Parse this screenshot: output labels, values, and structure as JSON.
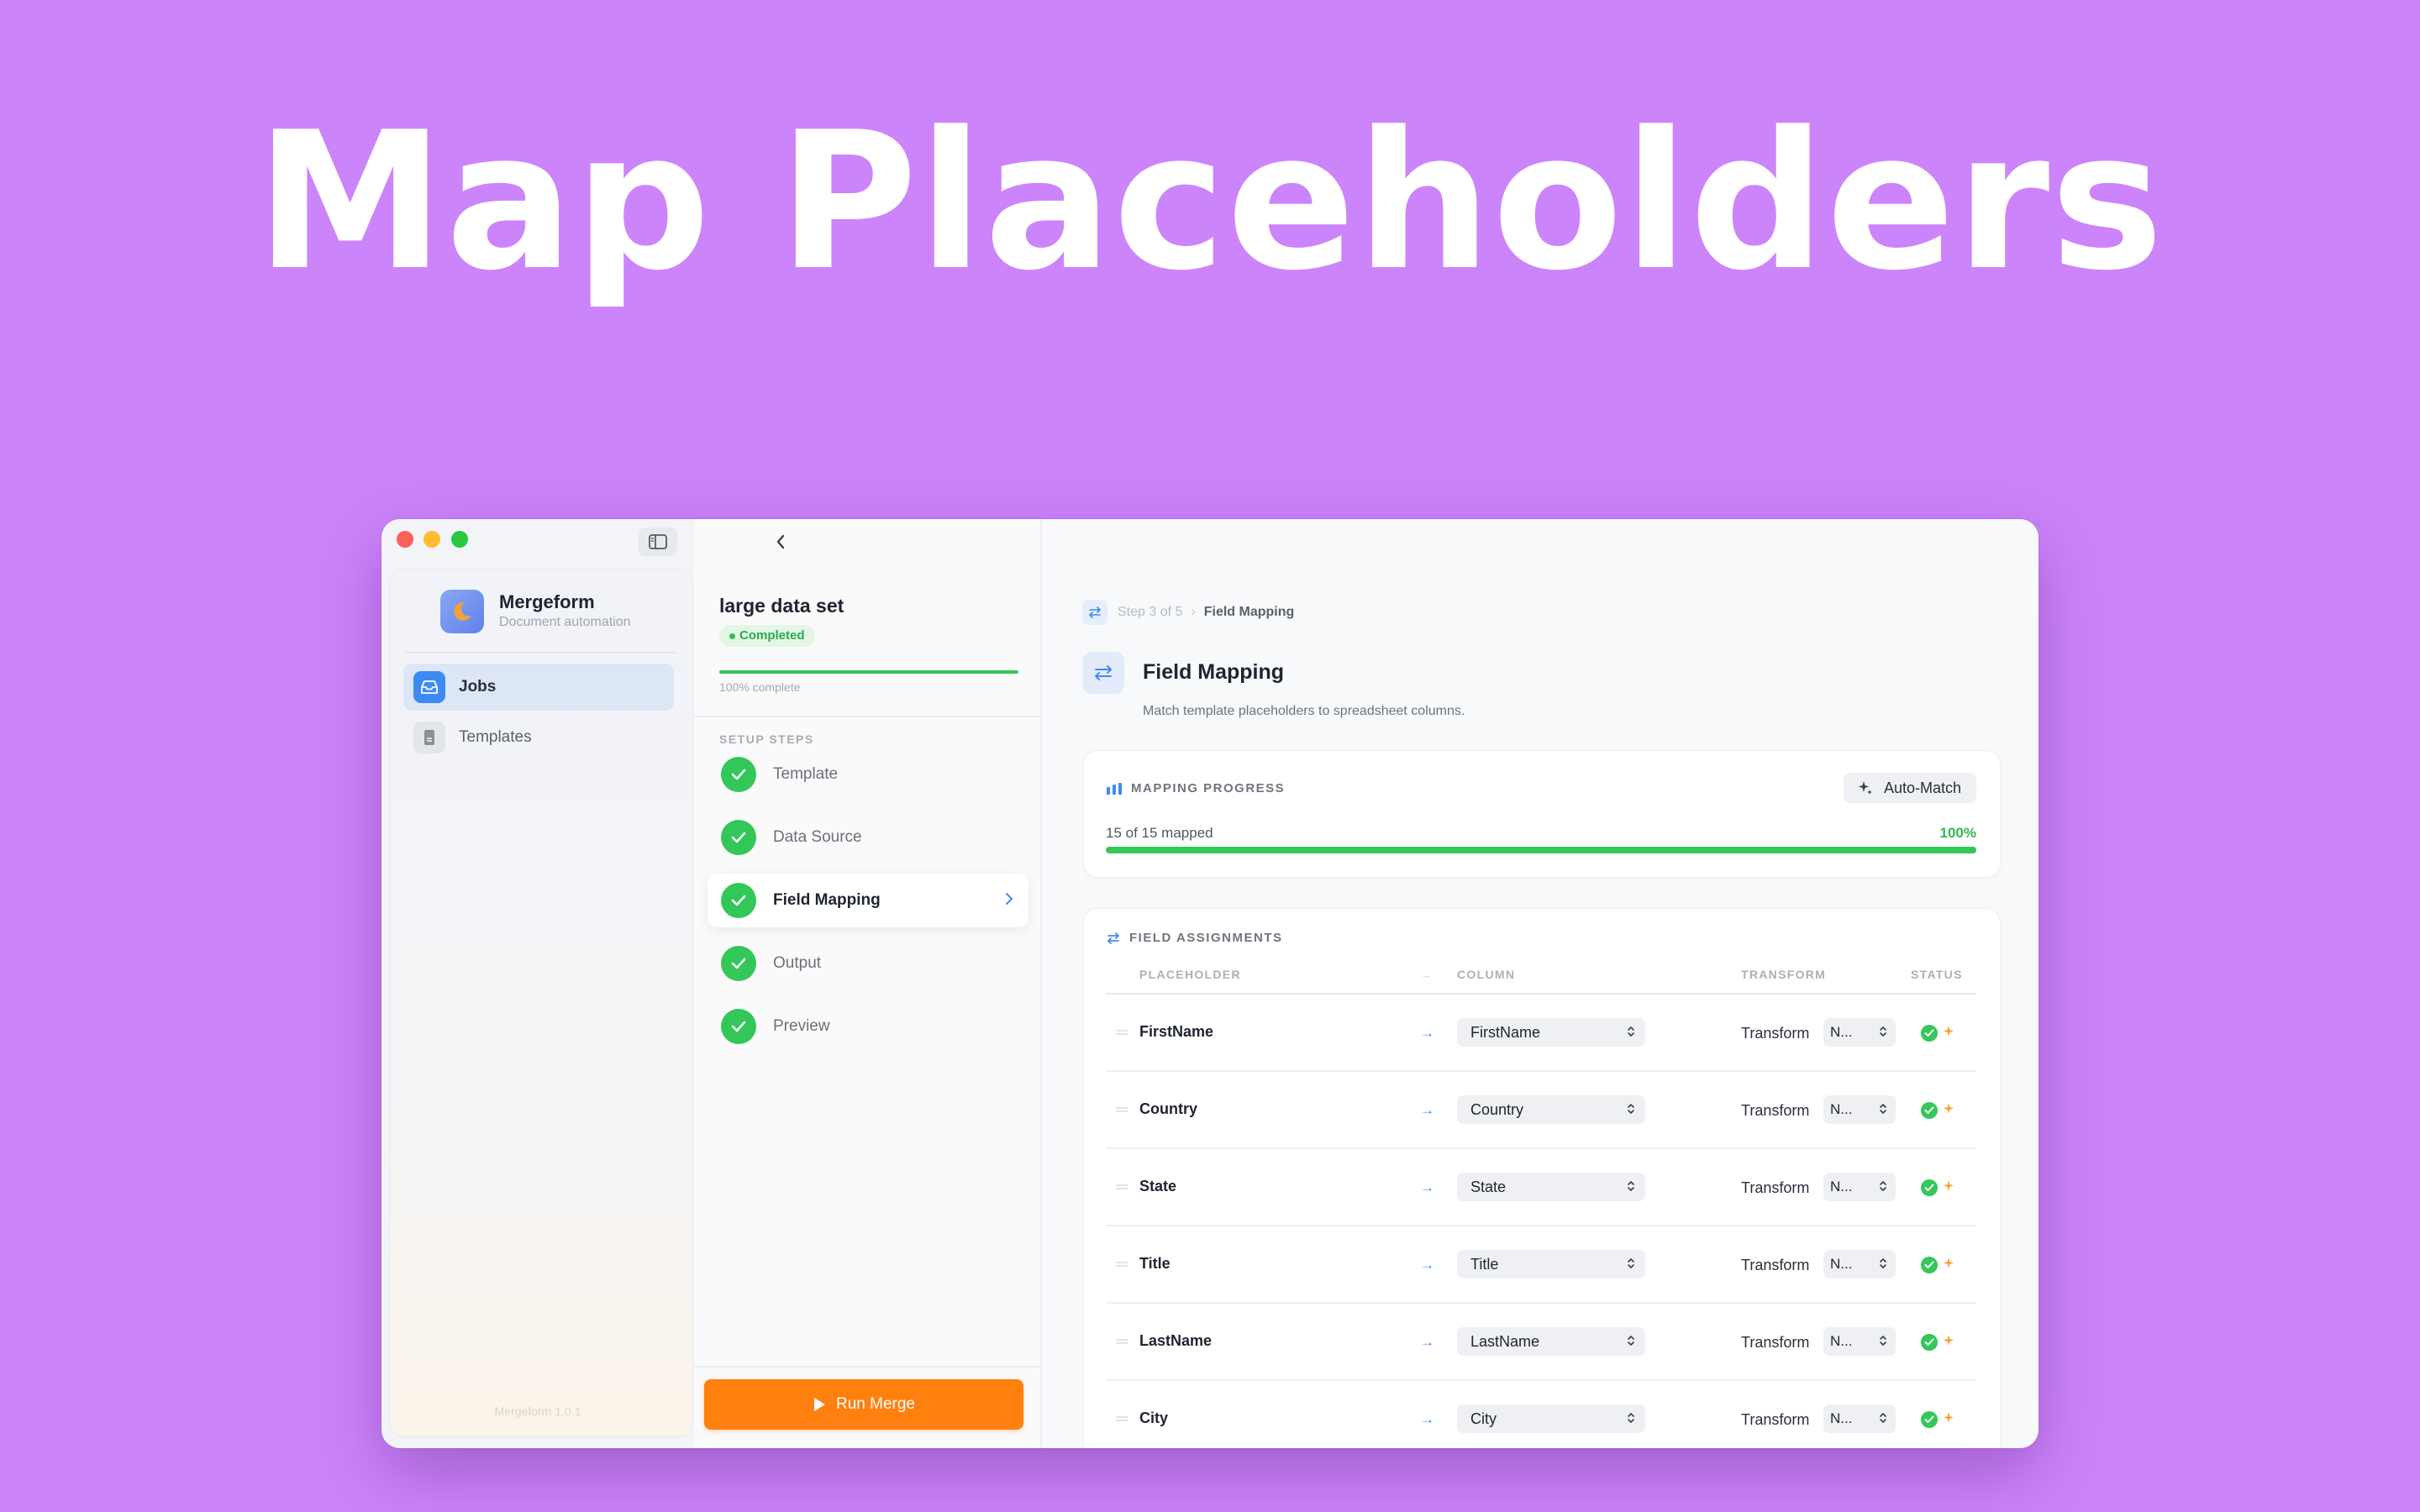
{
  "hero": {
    "title": "Map Placeholders"
  },
  "app": {
    "name": "Mergeform",
    "subtitle": "Document automation",
    "version": "Mergeform 1.0.1"
  },
  "sidebar": {
    "items": [
      {
        "label": "Jobs",
        "icon": "inbox-icon",
        "active": true
      },
      {
        "label": "Templates",
        "icon": "document-icon",
        "active": false
      }
    ]
  },
  "job": {
    "title": "large data set",
    "status": "Completed",
    "progress_text": "100% complete",
    "progress": 1.0
  },
  "steps": {
    "heading": "SETUP STEPS",
    "items": [
      {
        "label": "Template",
        "done": true
      },
      {
        "label": "Data Source",
        "done": true
      },
      {
        "label": "Field Mapping",
        "done": true,
        "active": true
      },
      {
        "label": "Output",
        "done": true
      },
      {
        "label": "Preview",
        "done": true
      }
    ]
  },
  "run_button": {
    "label": "Run Merge"
  },
  "breadcrumb": {
    "step": "Step 3 of 5",
    "current": "Field Mapping"
  },
  "page": {
    "title": "Field Mapping",
    "subtitle": "Match template placeholders to spreadsheet columns."
  },
  "progress_card": {
    "heading": "MAPPING PROGRESS",
    "auto_match_label": "Auto-Match",
    "mapped_text": "15 of 15 mapped",
    "percent_text": "100%",
    "fraction": 1.0
  },
  "assignments": {
    "heading": "FIELD ASSIGNMENTS",
    "columns": {
      "placeholder": "PLACEHOLDER",
      "arrow": "→",
      "column": "COLUMN",
      "transform": "TRANSFORM",
      "status": "STATUS"
    },
    "transform_label": "Transform",
    "rows": [
      {
        "placeholder": "FirstName",
        "column": "FirstName",
        "transform": "N..."
      },
      {
        "placeholder": "Country",
        "column": "Country",
        "transform": "N..."
      },
      {
        "placeholder": "State",
        "column": "State",
        "transform": "N..."
      },
      {
        "placeholder": "Title",
        "column": "Title",
        "transform": "N..."
      },
      {
        "placeholder": "LastName",
        "column": "LastName",
        "transform": "N..."
      },
      {
        "placeholder": "City",
        "column": "City",
        "transform": "N..."
      }
    ]
  },
  "colors": {
    "background": "#cc84fb",
    "accent": "#3d8bf2",
    "success": "#34c759",
    "run": "#ff7f0f"
  }
}
